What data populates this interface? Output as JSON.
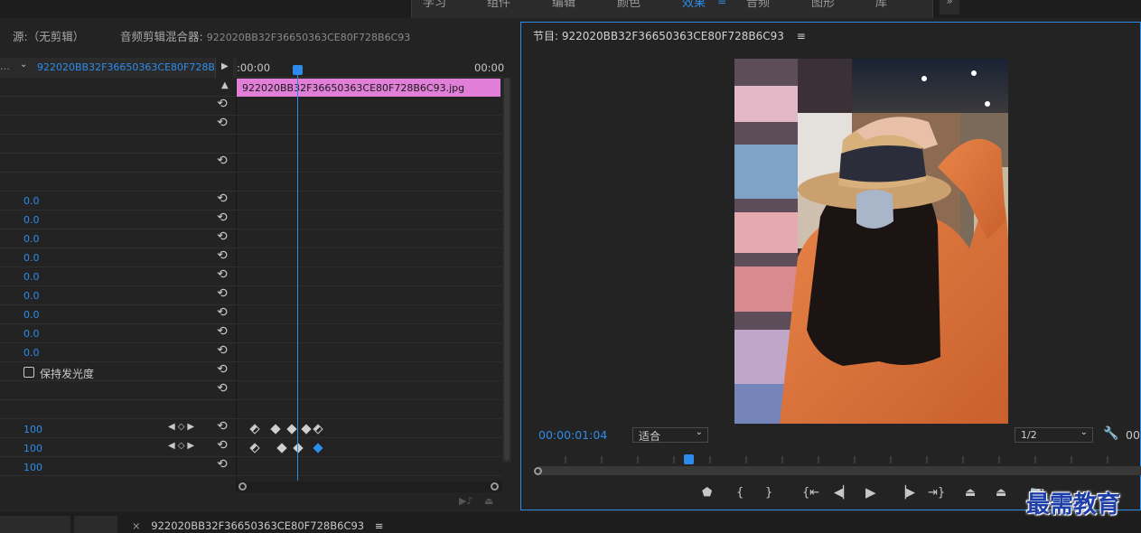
{
  "workspace_tabs": [
    {
      "label": "学习",
      "active": false
    },
    {
      "label": "组件",
      "active": false
    },
    {
      "label": "编辑",
      "active": false
    },
    {
      "label": "颜色",
      "active": false
    },
    {
      "label": "效果",
      "active": true
    },
    {
      "label": "音频",
      "active": false
    },
    {
      "label": "图形",
      "active": false
    },
    {
      "label": "库",
      "active": false
    }
  ],
  "workspace_more": "»",
  "left_panel": {
    "tab_source": "源:（无剪辑）",
    "tab_audio_mixer": "音频剪辑混合器:",
    "tab_audio_mixer_clip": "922020BB32F36650363CE80F728B6C93",
    "effect_controls_clip": "922020BB32F36650363CE80F728B6...",
    "ruler_start": ":00:00",
    "ruler_end": "00:00",
    "clip_name": "922020BB32F36650363CE80F728B6C93.jpg",
    "values": [
      "0.0",
      "0.0",
      "0.0",
      "0.0",
      "0.0",
      "0.0",
      "0.0",
      "0.0",
      "0.0"
    ],
    "preserve_luminance": "保持发光度",
    "opacity_values": [
      "100",
      "100",
      "100"
    ]
  },
  "program_monitor": {
    "title": "节目: 922020BB32F36650363CE80F728B6C93",
    "timecode": "00:00:01:04",
    "fit": "适合",
    "resolution": "1/2",
    "timecode_right": "00"
  },
  "bottom": {
    "sequence_tab": "922020BB32F36650363CE80F728B6C93"
  },
  "watermark": "最需教育",
  "colors": {
    "accent": "#2d8ceb",
    "clip": "#e07ed8"
  }
}
